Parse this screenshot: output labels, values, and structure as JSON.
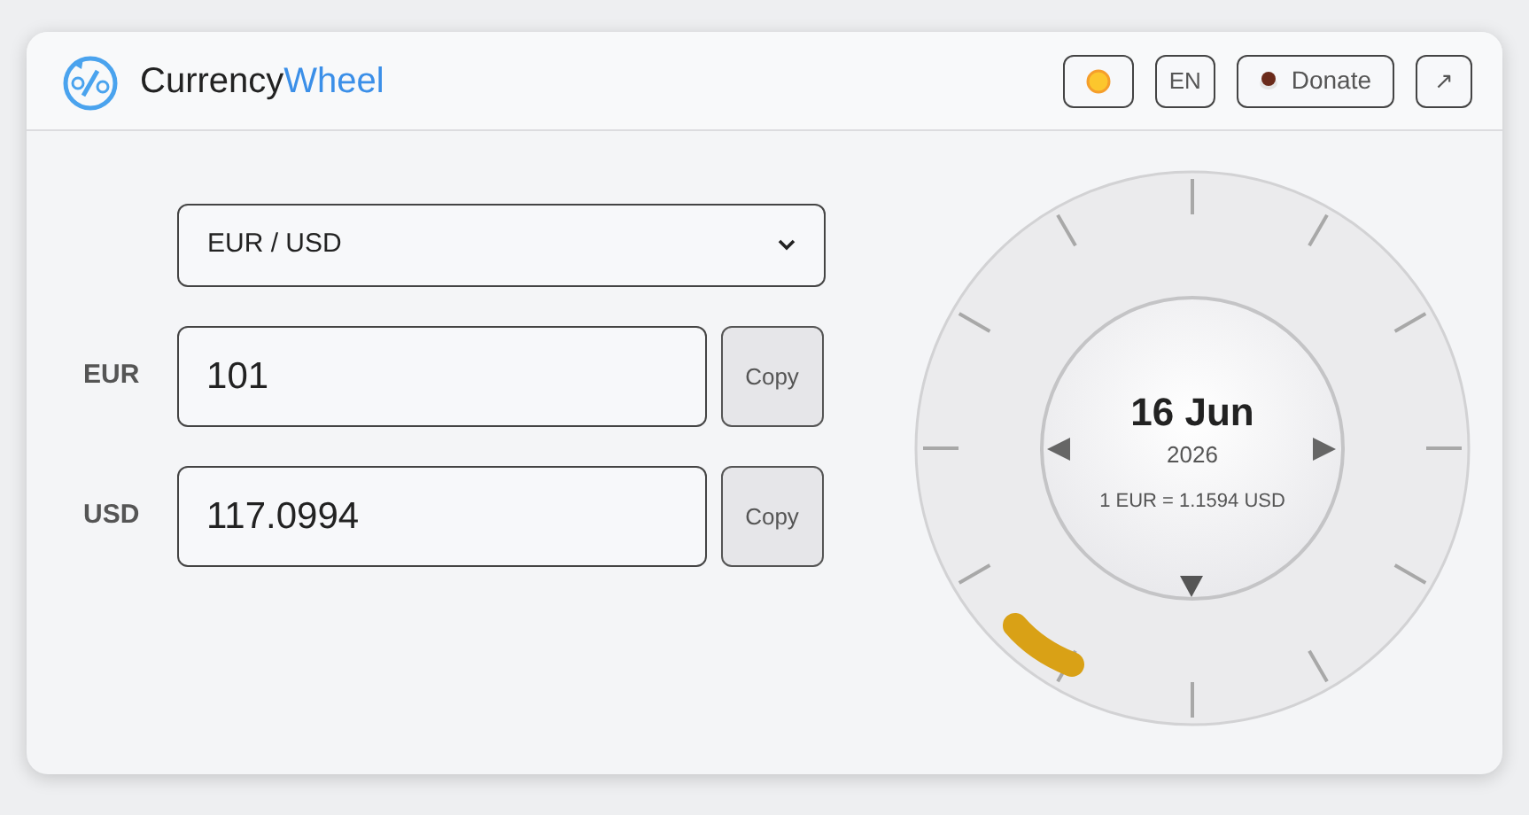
{
  "app": {
    "title_part1": "Currency",
    "title_part2": "Wheel"
  },
  "header_buttons": [
    {
      "kind": "theme"
    },
    {
      "kind": "text",
      "label": "EN"
    },
    {
      "kind": "donate",
      "label": "Donate"
    },
    {
      "kind": "popout",
      "label": "↗"
    }
  ],
  "pair_select": {
    "value": "EUR / USD"
  },
  "fields": [
    {
      "currency": "EUR",
      "value": "101",
      "button": "Copy"
    },
    {
      "currency": "USD",
      "value": "117.0994",
      "button": "Copy"
    }
  ],
  "wheel": {
    "date": "16 Jun",
    "year": "2026",
    "rate": "1 EUR = 1.1594 USD"
  }
}
